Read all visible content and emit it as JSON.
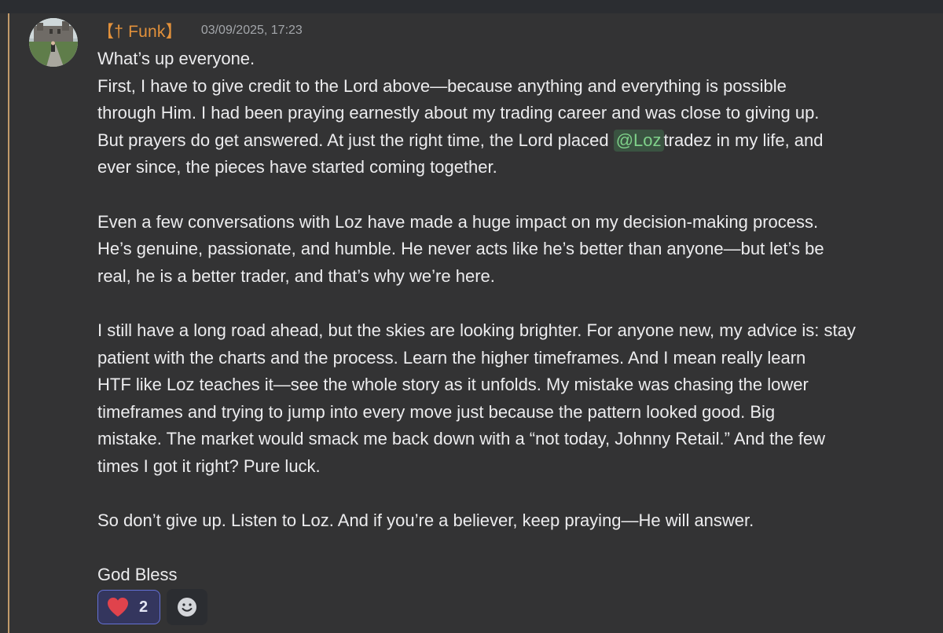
{
  "message": {
    "author": {
      "name": "【† Funk】",
      "color": "#e2913b"
    },
    "timestamp": "03/09/2025, 17:23",
    "mention_before": "But prayers do get answered. At just the right time, the Lord placed ",
    "mention": "@Loz",
    "mention_after": "tradez in my life, and",
    "lines": [
      "What’s up everyone.",
      "First, I have to give credit to the Lord above—because anything and everything is possible",
      "through Him. I had been praying earnestly about my trading career and was close to giving up.",
      "ever since, the pieces have started coming together.",
      "Even a few conversations with Loz have made a huge impact on my decision-making process.",
      "He’s genuine, passionate, and humble. He never acts like he’s better than anyone—but let’s be",
      "real, he is a better trader, and that’s why we’re here.",
      "I still have a long road ahead, but the skies are looking brighter. For anyone new, my advice is: stay",
      "patient with the charts and the process. Learn the higher timeframes. And I mean really learn",
      "HTF like Loz teaches it—see the whole story as it unfolds. My mistake was chasing the lower",
      "timeframes and trying to jump into every move just because the pattern looked good. Big",
      "mistake. The market would smack me back down with a “not today, Johnny Retail.” And the few",
      "times I got it right? Pure luck.",
      "So don’t give up. Listen to Loz. And if you’re a believer, keep praying—He will answer.",
      "God Bless"
    ],
    "reactions": [
      {
        "icon": "heart-icon",
        "count": "2",
        "active": true
      }
    ],
    "add_reaction_icon": "smiley-icon"
  },
  "colors": {
    "background": "#333334",
    "text": "#ececee",
    "mention_text": "#7fd18a",
    "highlight_bar": "#c19a6b",
    "reaction_border": "#6470d6",
    "heart": "#e0434c"
  }
}
